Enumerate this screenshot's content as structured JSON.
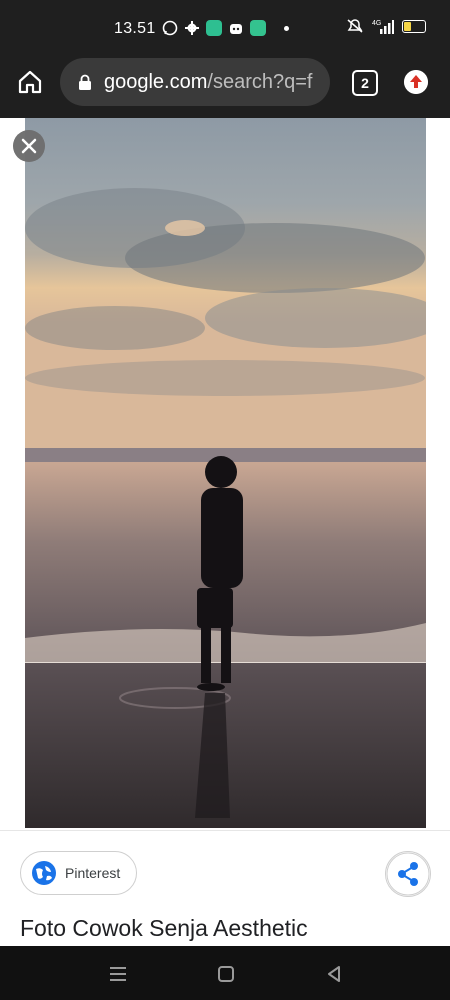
{
  "status_bar": {
    "time": "13.51",
    "icons": [
      "whatsapp-icon",
      "settings-icon",
      "app-icon",
      "app-icon",
      "app-icon",
      "notification-dot"
    ],
    "signal": "4G",
    "battery_level": 0.4
  },
  "browser": {
    "url_host": "google.com",
    "url_rest": "/search?q=f",
    "tab_count": "2"
  },
  "image_viewer": {
    "image_alt": "Silhouette of a boy standing on a beach at sunset",
    "source_label": "Pinterest",
    "title": "Foto Cowok Senja Aesthetic"
  },
  "nav_bar": {
    "buttons": [
      "menu",
      "home",
      "back"
    ]
  },
  "colors": {
    "bar_bg": "#1f1f1f",
    "url_bg": "#3a3a3a",
    "share_blue": "#1a73e8",
    "update_red": "#d93025"
  }
}
